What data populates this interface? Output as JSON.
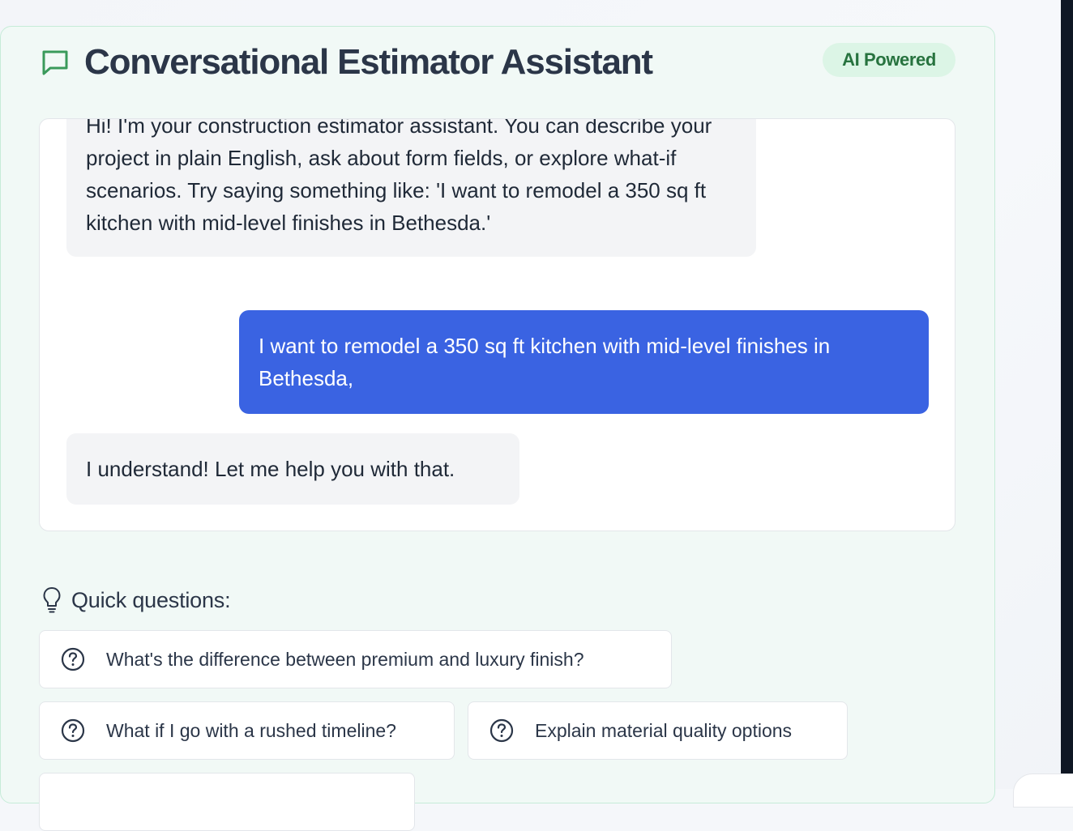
{
  "header": {
    "title": "Conversational Estimator Assistant",
    "icon": "chat-bubble-icon",
    "badge": "AI Powered",
    "accent_color": "#3a9a5b"
  },
  "chat": {
    "messages": [
      {
        "role": "assistant",
        "text": "Hi! I'm your construction estimator assistant. You can describe your project in plain English, ask about form fields, or explore what-if scenarios. Try saying something like: 'I want to remodel a 350 sq ft kitchen with mid-level finishes in Bethesda.'"
      },
      {
        "role": "user",
        "text": "I want to remodel a 350 sq ft kitchen with mid-level finishes in Bethesda,"
      },
      {
        "role": "assistant",
        "text": "I understand! Let me help you with that."
      }
    ],
    "user_bubble_color": "#3a63e2",
    "assistant_bubble_color": "#f3f4f6"
  },
  "quick_questions": {
    "label": "Quick questions:",
    "icon": "lightbulb-icon",
    "items": [
      {
        "label": "What's the difference between premium and luxury finish?",
        "icon": "help-circle-icon"
      },
      {
        "label": "What if I go with a rushed timeline?",
        "icon": "help-circle-icon"
      },
      {
        "label": "Explain material quality options",
        "icon": "help-circle-icon"
      }
    ]
  }
}
